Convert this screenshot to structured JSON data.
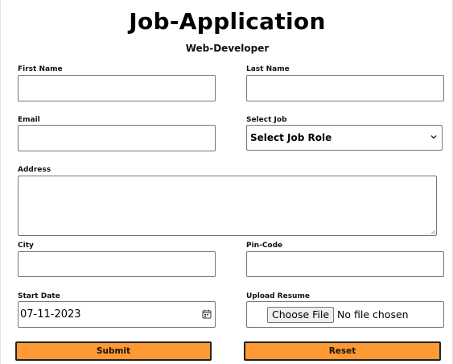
{
  "header": {
    "title": "Job-Application",
    "subtitle": "Web-Developer"
  },
  "form": {
    "first_name": {
      "label": "First Name",
      "value": ""
    },
    "last_name": {
      "label": "Last Name",
      "value": ""
    },
    "email": {
      "label": "Email",
      "value": ""
    },
    "job": {
      "label": "Select Job",
      "selected": "Select Job Role"
    },
    "address": {
      "label": "Address",
      "value": ""
    },
    "city": {
      "label": "City",
      "value": ""
    },
    "pincode": {
      "label": "Pin-Code",
      "value": ""
    },
    "start_date": {
      "label": "Start Date",
      "value": "07-11-2023"
    },
    "resume": {
      "label": "Upload Resume",
      "button": "Choose File",
      "status": "No file chosen"
    }
  },
  "actions": {
    "submit": "Submit",
    "reset": "Reset"
  },
  "colors": {
    "button_bg": "#ff9933"
  },
  "icons": {
    "select": "chevron-down-icon",
    "date": "calendar-icon"
  }
}
